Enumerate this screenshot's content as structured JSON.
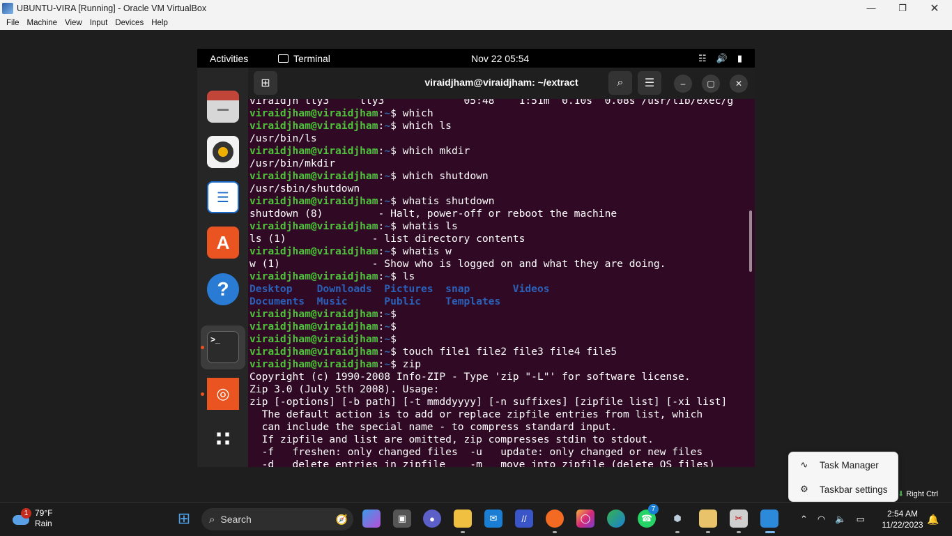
{
  "host": {
    "title": "UBUNTU-VIRA [Running] - Oracle VM VirtualBox",
    "menu": [
      "File",
      "Machine",
      "View",
      "Input",
      "Devices",
      "Help"
    ],
    "host_key": "Right Ctrl"
  },
  "ubuntu": {
    "activities": "Activities",
    "app_name": "Terminal",
    "clock": "Nov 22  05:54",
    "dock": [
      "files-icon",
      "rhythmbox-icon",
      "writer-icon",
      "app-center-icon",
      "help-icon",
      "terminal-icon",
      "ubuntu-icon",
      "show-apps-icon"
    ],
    "terminal_title": "viraidjham@viraidjham: ~/extract"
  },
  "terminal": {
    "prompt_user": "viraidjham@viraidjham",
    "prompt_sep": ":",
    "prompt_path": "~",
    "lines": [
      {
        "type": "out",
        "text": "viraidjh tty3     tty3             05:48    1:51m  0.10s  0.08s /usr/lib/exec/g"
      },
      {
        "type": "cmd",
        "text": "$ which"
      },
      {
        "type": "cmd",
        "text": "$ which ls"
      },
      {
        "type": "out",
        "text": "/usr/bin/ls"
      },
      {
        "type": "cmd",
        "text": "$ which mkdir"
      },
      {
        "type": "out",
        "text": "/usr/bin/mkdir"
      },
      {
        "type": "cmd",
        "text": "$ which shutdown"
      },
      {
        "type": "out",
        "text": "/usr/sbin/shutdown"
      },
      {
        "type": "cmd",
        "text": "$ whatis shutdown"
      },
      {
        "type": "out",
        "text": "shutdown (8)         - Halt, power-off or reboot the machine"
      },
      {
        "type": "cmd",
        "text": "$ whatis ls"
      },
      {
        "type": "out",
        "text": "ls (1)              - list directory contents"
      },
      {
        "type": "cmd",
        "text": "$ whatis w"
      },
      {
        "type": "out",
        "text": "w (1)               - Show who is logged on and what they are doing."
      },
      {
        "type": "cmd",
        "text": "$ ls"
      },
      {
        "type": "dir",
        "text": "Desktop    Downloads  Pictures  snap       Videos"
      },
      {
        "type": "dir",
        "text": "Documents  Music      Public    Templates"
      },
      {
        "type": "cmd",
        "text": "$"
      },
      {
        "type": "cmd",
        "text": "$"
      },
      {
        "type": "cmd",
        "text": "$"
      },
      {
        "type": "cmd",
        "text": "$ touch file1 file2 file3 file4 file5"
      },
      {
        "type": "cmd",
        "text": "$ zip"
      },
      {
        "type": "out",
        "text": "Copyright (c) 1990-2008 Info-ZIP - Type 'zip \"-L\"' for software license."
      },
      {
        "type": "out",
        "text": "Zip 3.0 (July 5th 2008). Usage:"
      },
      {
        "type": "out",
        "text": "zip [-options] [-b path] [-t mmddyyyy] [-n suffixes] [zipfile list] [-xi list]"
      },
      {
        "type": "out",
        "text": "  The default action is to add or replace zipfile entries from list, which"
      },
      {
        "type": "out",
        "text": "  can include the special name - to compress standard input."
      },
      {
        "type": "out",
        "text": "  If zipfile and list are omitted, zip compresses stdin to stdout."
      },
      {
        "type": "out",
        "text": "  -f   freshen: only changed files  -u   update: only changed or new files"
      },
      {
        "type": "out",
        "text": "  -d   delete entries in zipfile    -m   move into zipfile (delete OS files)"
      }
    ]
  },
  "context_menu": {
    "task_manager": "Task Manager",
    "taskbar_settings": "Taskbar settings"
  },
  "taskbar": {
    "weather_temp": "79°F",
    "weather_desc": "Rain",
    "weather_badge": "1",
    "search_label": "Search",
    "whatsapp_badge": "7",
    "time": "2:54 AM",
    "date": "11/22/2023",
    "colors": {
      "accent": "#0078d4",
      "ubuntu_orange": "#e95420",
      "terminal_bg": "#300a24",
      "prompt_green": "#4ec23b"
    }
  }
}
